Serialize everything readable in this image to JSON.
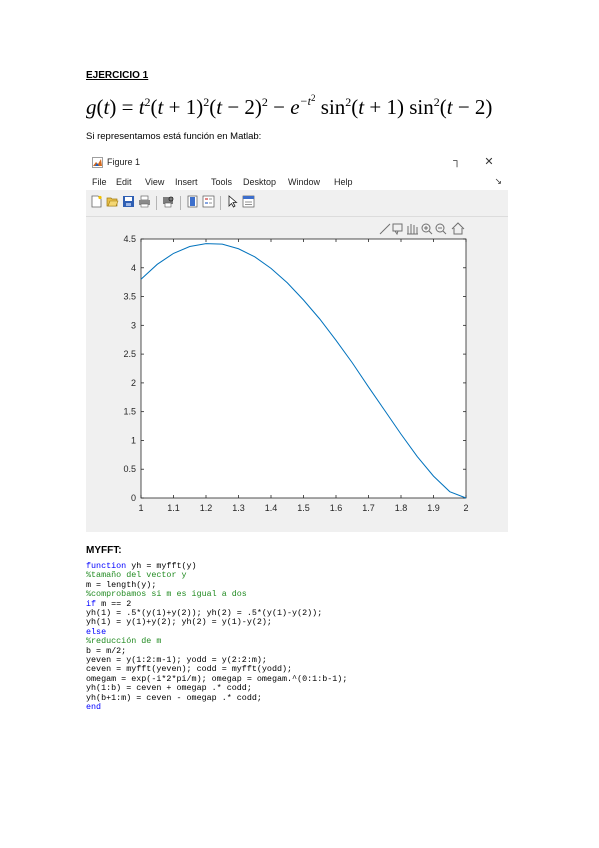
{
  "document": {
    "heading": "EJERCICIO 1",
    "equation_latex": "g(t) = t^2(t+1)^2(t-2)^2 - e^{-t^2}\\sin^2(t+1)\\sin^2(t-2)",
    "intro": "Si representamos está función en Matlab:",
    "section_title": "MYFFT:"
  },
  "figure_window": {
    "title": "Figure 1",
    "menu": [
      "File",
      "Edit",
      "View",
      "Insert",
      "Tools",
      "Desktop",
      "Window",
      "Help"
    ],
    "toolbar_icons": [
      "new-figure-icon",
      "open-file-icon",
      "save-icon",
      "print-icon",
      "print-preview-icon",
      "colorbar-icon",
      "legend-icon",
      "pointer-icon",
      "property-editor-icon"
    ],
    "axes_toolbar_icons": [
      "brush-icon",
      "data-tips-icon",
      "pan-icon",
      "zoom-in-icon",
      "zoom-out-icon",
      "home-icon"
    ]
  },
  "chart_data": {
    "type": "line",
    "title": "",
    "xlabel": "",
    "ylabel": "",
    "xlim": [
      1,
      2
    ],
    "ylim": [
      0,
      4.5
    ],
    "xticks": [
      "1",
      "1.1",
      "1.2",
      "1.3",
      "1.4",
      "1.5",
      "1.6",
      "1.7",
      "1.8",
      "1.9",
      "2"
    ],
    "yticks": [
      "0",
      "0.5",
      "1",
      "1.5",
      "2",
      "2.5",
      "3",
      "3.5",
      "4",
      "4.5"
    ],
    "grid": false,
    "line_color": "#0072bd",
    "series": [
      {
        "x": [
          1.0,
          1.05,
          1.1,
          1.15,
          1.2,
          1.25,
          1.3,
          1.35,
          1.4,
          1.45,
          1.5,
          1.55,
          1.6,
          1.65,
          1.7,
          1.75,
          1.8,
          1.85,
          1.9,
          1.95,
          2.0
        ],
        "values": [
          3.8,
          4.06,
          4.25,
          4.37,
          4.42,
          4.41,
          4.33,
          4.19,
          3.99,
          3.74,
          3.44,
          3.11,
          2.74,
          2.35,
          1.93,
          1.52,
          1.11,
          0.72,
          0.38,
          0.11,
          0.0
        ]
      }
    ]
  },
  "code": {
    "colors": {
      "keyword": "#0000ff",
      "comment": "#228b22",
      "text": "#000000"
    },
    "lines": [
      {
        "kind": "kw",
        "text": "function",
        "rest": " yh = myfft(y)"
      },
      {
        "kind": "cm",
        "text": "%tamaño del vector y"
      },
      {
        "kind": "tx",
        "text": "m = length(y);"
      },
      {
        "kind": "cm",
        "text": "%comprobamos si m es igual a dos"
      },
      {
        "kind": "kw",
        "text": "if",
        "rest": " m == 2"
      },
      {
        "kind": "tx",
        "text": "yh(1) = .5*(y(1)+y(2)); yh(2) = .5*(y(1)-y(2));"
      },
      {
        "kind": "tx",
        "text": "yh(1) = y(1)+y(2); yh(2) = y(1)-y(2);"
      },
      {
        "kind": "kw",
        "text": "else"
      },
      {
        "kind": "cm",
        "text": "%reducción de m"
      },
      {
        "kind": "tx",
        "text": "b = m/2;"
      },
      {
        "kind": "tx",
        "text": "yeven = y(1:2:m-1); yodd = y(2:2:m);"
      },
      {
        "kind": "tx",
        "text": "ceven = myfft(yeven); codd = myfft(yodd);"
      },
      {
        "kind": "tx",
        "text": "omegam = exp(-i*2*pi/m); omegap = omegam.^(0:1:b-1);"
      },
      {
        "kind": "tx",
        "text": "yh(1:b) = ceven + omegap .* codd;"
      },
      {
        "kind": "tx",
        "text": "yh(b+1:m) = ceven - omegap .* codd;"
      },
      {
        "kind": "kw",
        "text": "end"
      }
    ]
  }
}
